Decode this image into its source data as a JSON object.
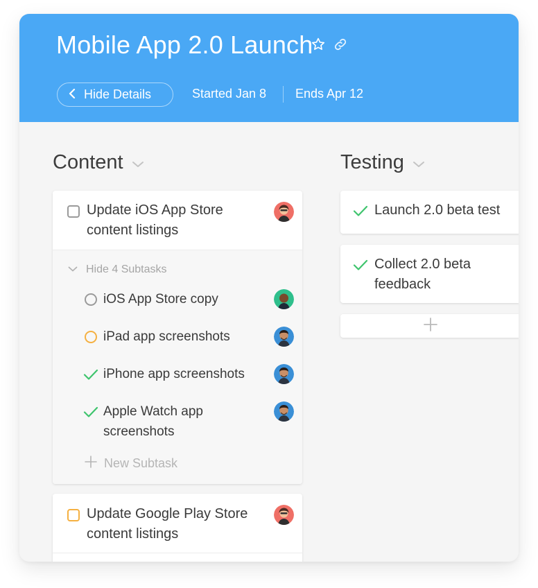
{
  "project": {
    "title": "Mobile App 2.0 Launch",
    "hide_details_label": "Hide Details",
    "started": "Started Jan 8",
    "ends": "Ends Apr 12"
  },
  "columns": [
    {
      "title": "Content"
    },
    {
      "title": "Testing"
    }
  ],
  "content": {
    "task1": {
      "title_line1": "Update iOS App Store",
      "title_line2": "content listings",
      "status": "incomplete"
    },
    "subtasks_toggle": "Hide 4 Subtasks",
    "subtasks": [
      {
        "label": "iOS App Store copy",
        "status": "not-started"
      },
      {
        "label": "iPad app screenshots",
        "status": "in-progress"
      },
      {
        "label": "iPhone app screenshots",
        "status": "done"
      },
      {
        "label_line1": "Apple Watch app",
        "label_line2": "screenshots",
        "status": "done"
      }
    ],
    "new_subtask": "New Subtask",
    "task2": {
      "title_line1": "Update Google Play Store",
      "title_line2": "content listings",
      "status": "in-progress"
    }
  },
  "testing": {
    "task1": {
      "title": "Launch 2.0 beta test",
      "status": "done"
    },
    "task2": {
      "title_line1": "Collect 2.0 beta",
      "title_line2": "feedback",
      "status": "done"
    }
  },
  "colors": {
    "header": "#4aa8f5",
    "done": "#3ec46d",
    "in_progress": "#f5b041",
    "not_started": "#9a9a9a"
  }
}
